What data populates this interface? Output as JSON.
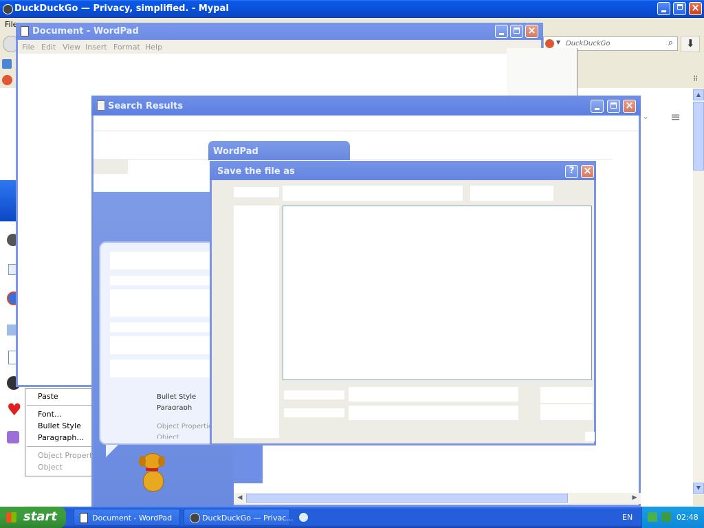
{
  "browser": {
    "title": "DuckDuckGo — Privacy, simplified. - Mypal",
    "menu_file": "File",
    "search_placeholder": "DuckDuckGo"
  },
  "wordpad": {
    "title": "Document - WordPad",
    "menu": [
      "File",
      "Edit",
      "View",
      "Insert",
      "Format",
      "Help"
    ]
  },
  "search_results": {
    "title": "Search Results"
  },
  "wordpad_small": {
    "title": "WordPad"
  },
  "save_dialog": {
    "title": "Save the file as",
    "help_label": "?"
  },
  "context_menu": {
    "items": [
      "Paste",
      "Font...",
      "Bullet Style",
      "Paragraph...",
      "Object Properties",
      "Object"
    ],
    "disabled": [
      false,
      false,
      false,
      false,
      true,
      true
    ]
  },
  "ghost_menu": {
    "items": [
      "Bullet Style",
      "Paragraph",
      "Object Properties",
      "Object"
    ]
  },
  "taskbar": {
    "start_label": "start",
    "tasks": [
      "Document - WordPad",
      "DuckDuckGo — Privac..."
    ],
    "language": "EN",
    "clock": "02:48"
  },
  "colors": {
    "xp_blue": "#0b47c6",
    "start_green": "#3d9a3d",
    "tray_blue": "#0f88d8"
  }
}
